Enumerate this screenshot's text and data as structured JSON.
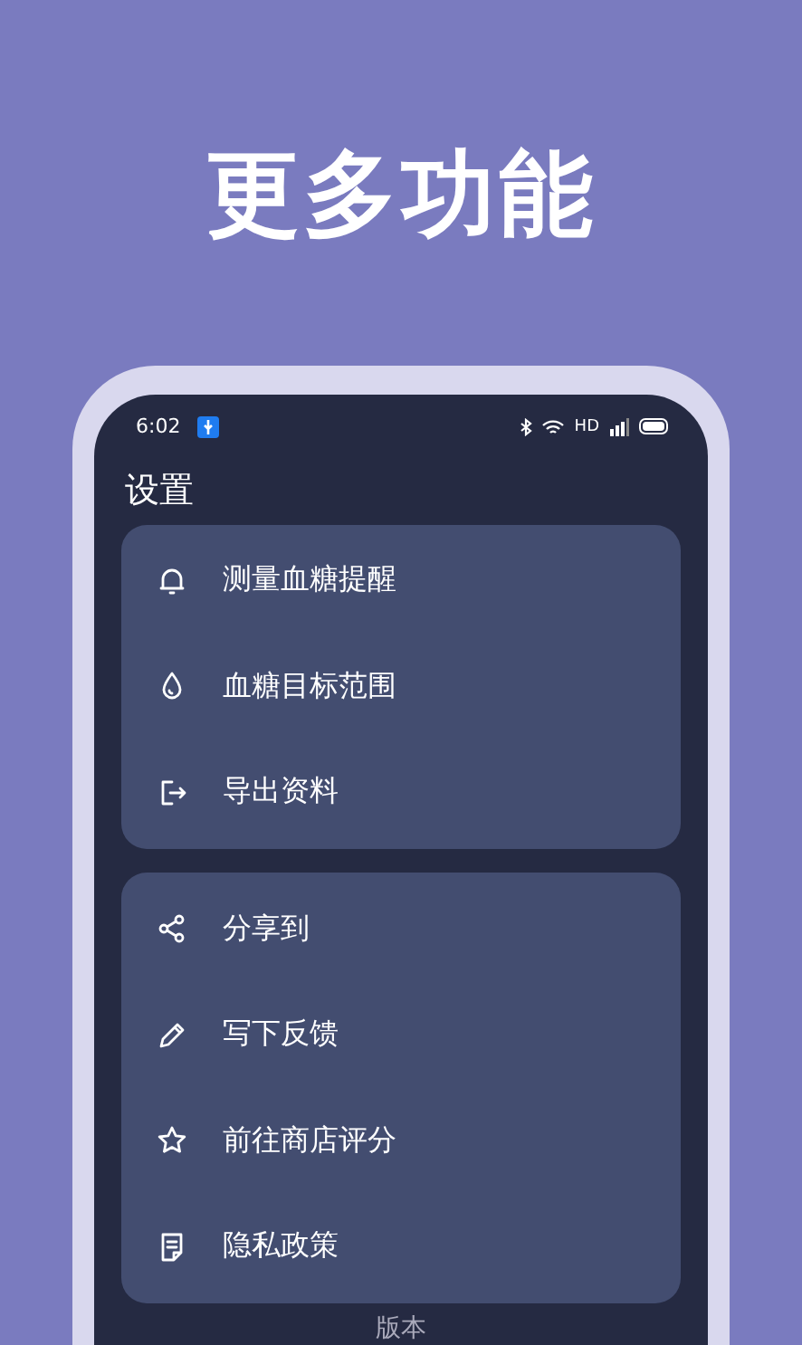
{
  "headline": "更多功能",
  "status_bar": {
    "time": "6:02",
    "network": "HD"
  },
  "screen_title": "设置",
  "groups": [
    {
      "items": [
        {
          "label": "测量血糖提醒"
        },
        {
          "label": "血糖目标范围"
        },
        {
          "label": "导出资料"
        }
      ]
    },
    {
      "items": [
        {
          "label": "分享到"
        },
        {
          "label": "写下反馈"
        },
        {
          "label": "前往商店评分"
        },
        {
          "label": "隐私政策"
        }
      ]
    }
  ],
  "footer": "版本"
}
